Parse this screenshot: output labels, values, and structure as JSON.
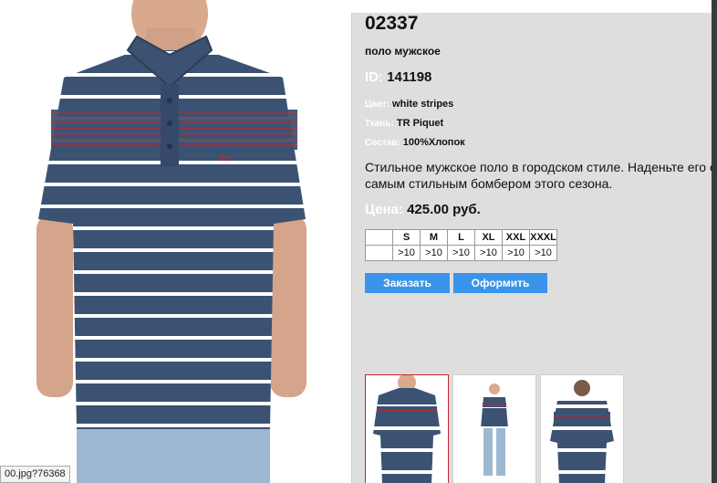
{
  "product": {
    "code": "02337",
    "name": "поло мужское",
    "id_label": "ID:",
    "id_value": "141198",
    "color_label": "Цвет:",
    "color_value": "white stripes",
    "fabric_label": "Ткань:",
    "fabric_value": "TR Piquet",
    "composition_label": "Состав:",
    "composition_value": "100%Хлопок",
    "description_line1": "Стильное мужское поло в городском стиле. Наденьте его с",
    "description_line2": "самым стильным бомбером этого сезона.",
    "price_label": "Цена:",
    "price_value": "425.00 руб."
  },
  "sizes": {
    "headers": [
      "",
      "S",
      "M",
      "L",
      "XL",
      "XXL",
      "XXXL"
    ],
    "stock": [
      "",
      ">10",
      ">10",
      ">10",
      ">10",
      ">10",
      ">10"
    ]
  },
  "actions": {
    "order_label": "Заказать",
    "checkout_label": "Оформить"
  },
  "status_bar": {
    "text": "00.jpg?76368"
  },
  "colors": {
    "panel_bg": "#dedede",
    "button_bg": "#3a95ea",
    "shirt_navy": "#3c5273",
    "stripe_red": "#a3303a",
    "active_thumb_border": "#c0282d"
  }
}
